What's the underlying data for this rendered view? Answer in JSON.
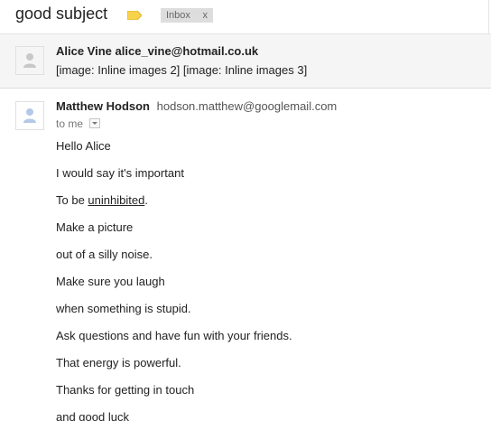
{
  "thread": {
    "subject": "good subject",
    "label_chip": "Inbox",
    "label_chip_close": "x",
    "label_color": "#f7d24a"
  },
  "collapsed_message": {
    "sender_name": "Alice Vine",
    "sender_email": "alice_vine@hotmail.co.uk",
    "snippet": "[image: Inline images 2] [image: Inline images 3]"
  },
  "expanded_message": {
    "sender_name": "Matthew Hodson",
    "sender_email": "hodson.matthew@googlemail.com",
    "to": "to me",
    "body": [
      {
        "pre": "Hello Alice",
        "link": "",
        "post": ""
      },
      {
        "pre": "I would say it's important",
        "link": "",
        "post": ""
      },
      {
        "pre": "To be ",
        "link": "uninhibited",
        "post": "."
      },
      {
        "pre": "Make a picture",
        "link": "",
        "post": ""
      },
      {
        "pre": "out of a silly noise.",
        "link": "",
        "post": ""
      },
      {
        "pre": "Make sure you laugh",
        "link": "",
        "post": ""
      },
      {
        "pre": "when something is stupid.",
        "link": "",
        "post": ""
      },
      {
        "pre": "Ask questions and have fun with your friends.",
        "link": "",
        "post": ""
      },
      {
        "pre": "That energy is powerful.",
        "link": "",
        "post": ""
      },
      {
        "pre": "Thanks for getting in touch",
        "link": "",
        "post": ""
      },
      {
        "pre": "and good luck",
        "link": "",
        "post": ""
      }
    ]
  }
}
